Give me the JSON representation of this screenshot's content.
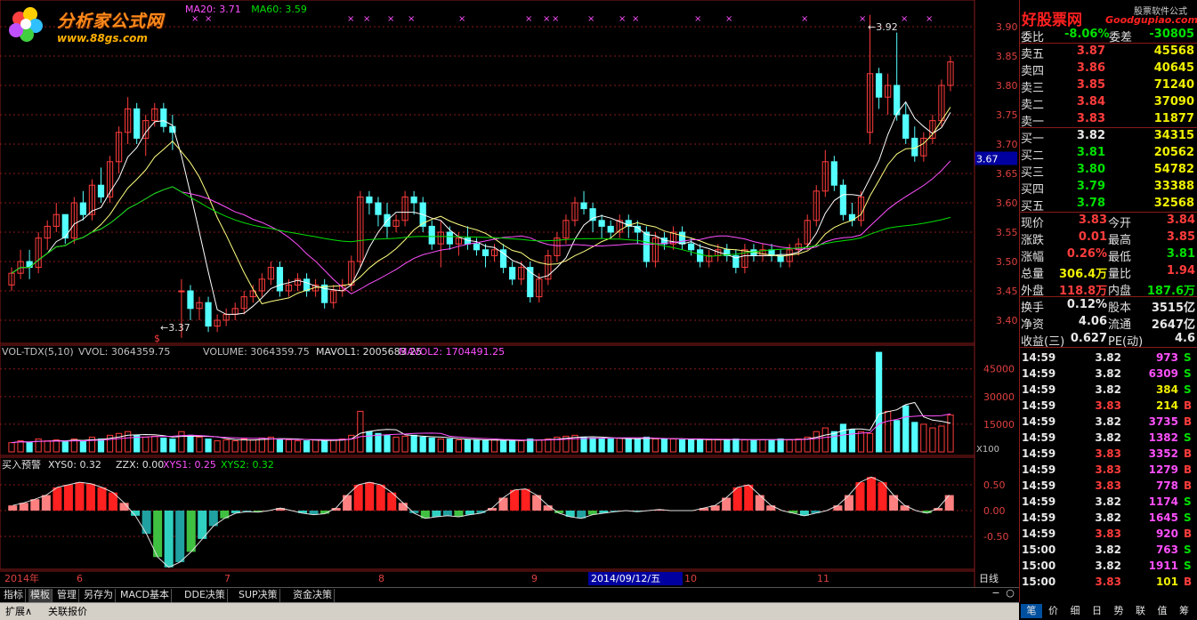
{
  "logo": {
    "title": "分析家公式网",
    "url": "www.88gs.com"
  },
  "ma_legend": [
    {
      "label": "MA20: 3.71",
      "color": "#ff50ff"
    },
    {
      "label": "MA60: 3.59",
      "color": "#00e000"
    }
  ],
  "brand": {
    "name": "好股票网",
    "url": "Goodgupiao.com",
    "sub": "股票软件公式"
  },
  "price_axis": [
    "3.90",
    "3.85",
    "3.80",
    "3.75",
    "3.70",
    "3.65",
    "3.60",
    "3.55",
    "3.50",
    "3.45",
    "3.40"
  ],
  "price_marker": "3.67",
  "price_high_label": "3.92",
  "price_low_label": "3.37",
  "vol_legend": {
    "name": "VOL-TDX(5,10)",
    "vvol": "VVOL: 3064359.75",
    "volume": "VOLUME: 3064359.75",
    "mavol1": "MAVOL1: 2005683.25",
    "mavol2": "MAVOL2: 1704491.25"
  },
  "vol_axis": [
    "45000",
    "30000",
    "15000"
  ],
  "vol_unit": "X100",
  "ind_legend": {
    "name": "买入预警",
    "xys0": "XYS0: 0.32",
    "zzx": "ZZX: 0.00",
    "xys1": "XYS1: 0.25",
    "xys2": "XYS2: 0.32"
  },
  "ind_axis": [
    "0.50",
    "0.00",
    "-0.50"
  ],
  "x_axis": [
    {
      "label": "2014年",
      "pos": 5
    },
    {
      "label": "6",
      "pos": 86
    },
    {
      "label": "7",
      "pos": 252
    },
    {
      "label": "8",
      "pos": 425
    },
    {
      "label": "9",
      "pos": 597
    },
    {
      "label": "10",
      "pos": 769
    },
    {
      "label": "11",
      "pos": 918
    }
  ],
  "date_cursor": "2014/09/12/五",
  "day_label": "日线",
  "quote": {
    "webi_label": "委比",
    "webi_value": "-8.06%",
    "wecha_label": "委差",
    "wecha_value": "-30805",
    "asks": [
      {
        "label": "卖五",
        "price": "3.87",
        "vol": "45568"
      },
      {
        "label": "卖四",
        "price": "3.86",
        "vol": "40645"
      },
      {
        "label": "卖三",
        "price": "3.85",
        "vol": "71240"
      },
      {
        "label": "卖二",
        "price": "3.84",
        "vol": "37090"
      },
      {
        "label": "卖一",
        "price": "3.83",
        "vol": "11877"
      }
    ],
    "bids": [
      {
        "label": "买一",
        "price": "3.82",
        "vol": "34315"
      },
      {
        "label": "买二",
        "price": "3.81",
        "vol": "20562"
      },
      {
        "label": "买三",
        "price": "3.80",
        "vol": "54782"
      },
      {
        "label": "买四",
        "price": "3.79",
        "vol": "33388"
      },
      {
        "label": "买五",
        "price": "3.78",
        "vol": "32568"
      }
    ],
    "stats": [
      {
        "k1": "现价",
        "v1": "3.83",
        "c1": "red",
        "k2": "今开",
        "v2": "3.84",
        "c2": "red"
      },
      {
        "k1": "涨跌",
        "v1": "0.01",
        "c1": "red",
        "k2": "最高",
        "v2": "3.85",
        "c2": "red"
      },
      {
        "k1": "涨幅",
        "v1": "0.26%",
        "c1": "red",
        "k2": "最低",
        "v2": "3.81",
        "c2": "green"
      },
      {
        "k1": "总量",
        "v1": "306.4万",
        "c1": "yellow",
        "k2": "量比",
        "v2": "1.94",
        "c2": "red"
      },
      {
        "k1": "外盘",
        "v1": "118.8万",
        "c1": "red",
        "k2": "内盘",
        "v2": "187.6万",
        "c2": "green"
      },
      {
        "k1": "换手",
        "v1": "0.12%",
        "c1": "white",
        "k2": "股本",
        "v2": "3515亿",
        "c2": "white"
      },
      {
        "k1": "净资",
        "v1": "4.06",
        "c1": "white",
        "k2": "流通",
        "v2": "2647亿",
        "c2": "white"
      },
      {
        "k1": "收益(三)",
        "v1": "0.627",
        "c1": "white",
        "k2": "PE(动)",
        "v2": "4.6",
        "c2": "white"
      }
    ]
  },
  "ticks": [
    {
      "time": "14:59",
      "price": "3.82",
      "pc": "white",
      "vol": "973",
      "vc": "magenta",
      "side": "S"
    },
    {
      "time": "14:59",
      "price": "3.82",
      "pc": "white",
      "vol": "6309",
      "vc": "magenta",
      "side": "S"
    },
    {
      "time": "14:59",
      "price": "3.82",
      "pc": "white",
      "vol": "384",
      "vc": "yellow",
      "side": "S"
    },
    {
      "time": "14:59",
      "price": "3.83",
      "pc": "red",
      "vol": "214",
      "vc": "yellow",
      "side": "B"
    },
    {
      "time": "14:59",
      "price": "3.82",
      "pc": "white",
      "vol": "3735",
      "vc": "magenta",
      "side": "B"
    },
    {
      "time": "14:59",
      "price": "3.82",
      "pc": "white",
      "vol": "1382",
      "vc": "magenta",
      "side": "S"
    },
    {
      "time": "14:59",
      "price": "3.83",
      "pc": "red",
      "vol": "3352",
      "vc": "magenta",
      "side": "B"
    },
    {
      "time": "14:59",
      "price": "3.83",
      "pc": "red",
      "vol": "1279",
      "vc": "magenta",
      "side": "B"
    },
    {
      "time": "14:59",
      "price": "3.83",
      "pc": "red",
      "vol": "778",
      "vc": "magenta",
      "side": "B"
    },
    {
      "time": "14:59",
      "price": "3.82",
      "pc": "white",
      "vol": "1174",
      "vc": "magenta",
      "side": "S"
    },
    {
      "time": "14:59",
      "price": "3.82",
      "pc": "white",
      "vol": "1645",
      "vc": "magenta",
      "side": "S"
    },
    {
      "time": "14:59",
      "price": "3.83",
      "pc": "red",
      "vol": "920",
      "vc": "magenta",
      "side": "B"
    },
    {
      "time": "15:00",
      "price": "3.82",
      "pc": "white",
      "vol": "763",
      "vc": "magenta",
      "side": "S"
    },
    {
      "time": "15:00",
      "price": "3.82",
      "pc": "white",
      "vol": "1911",
      "vc": "magenta",
      "side": "S"
    },
    {
      "time": "15:00",
      "price": "3.83",
      "pc": "red",
      "vol": "101",
      "vc": "yellow",
      "side": "B"
    }
  ],
  "tabs": [
    "指标",
    "模板",
    "管理",
    "另存为",
    "MACD基本",
    "DDE决策",
    "SUP决策",
    "资金决策"
  ],
  "status_tabs": [
    "扩展∧",
    "关联报价"
  ],
  "right_tabs": [
    "笔",
    "价",
    "细",
    "日",
    "势",
    "联",
    "值",
    "筹"
  ],
  "colors": {
    "up": "#ff3c3c",
    "down": "#54ffff",
    "grid": "#8a1a1a",
    "ma5": "#ffffff",
    "ma10": "#ffff80",
    "ma20": "#ff50ff",
    "ma60": "#00e000"
  },
  "chart_data": {
    "type": "candlestick",
    "ylim": [
      3.37,
      3.92
    ],
    "ohlc": [
      [
        3.46,
        3.49,
        3.45,
        3.48
      ],
      [
        3.48,
        3.52,
        3.47,
        3.5
      ],
      [
        3.5,
        3.52,
        3.47,
        3.49
      ],
      [
        3.49,
        3.55,
        3.48,
        3.54
      ],
      [
        3.54,
        3.57,
        3.52,
        3.56
      ],
      [
        3.56,
        3.6,
        3.55,
        3.58
      ],
      [
        3.58,
        3.58,
        3.53,
        3.54
      ],
      [
        3.54,
        3.61,
        3.53,
        3.6
      ],
      [
        3.6,
        3.62,
        3.57,
        3.58
      ],
      [
        3.58,
        3.64,
        3.57,
        3.63
      ],
      [
        3.63,
        3.66,
        3.6,
        3.61
      ],
      [
        3.61,
        3.68,
        3.6,
        3.67
      ],
      [
        3.67,
        3.73,
        3.65,
        3.72
      ],
      [
        3.72,
        3.78,
        3.7,
        3.76
      ],
      [
        3.76,
        3.77,
        3.7,
        3.71
      ],
      [
        3.71,
        3.75,
        3.68,
        3.74
      ],
      [
        3.74,
        3.77,
        3.73,
        3.76
      ],
      [
        3.76,
        3.77,
        3.72,
        3.73
      ],
      [
        3.73,
        3.75,
        3.69,
        3.72
      ],
      [
        3.45,
        3.47,
        3.37,
        3.45
      ],
      [
        3.45,
        3.46,
        3.4,
        3.42
      ],
      [
        3.42,
        3.44,
        3.4,
        3.43
      ],
      [
        3.43,
        3.44,
        3.38,
        3.39
      ],
      [
        3.39,
        3.41,
        3.38,
        3.4
      ],
      [
        3.4,
        3.42,
        3.39,
        3.41
      ],
      [
        3.41,
        3.43,
        3.4,
        3.42
      ],
      [
        3.42,
        3.45,
        3.41,
        3.44
      ],
      [
        3.44,
        3.46,
        3.43,
        3.45
      ],
      [
        3.45,
        3.48,
        3.44,
        3.47
      ],
      [
        3.47,
        3.5,
        3.46,
        3.49
      ],
      [
        3.49,
        3.5,
        3.44,
        3.45
      ],
      [
        3.45,
        3.47,
        3.44,
        3.46
      ],
      [
        3.46,
        3.48,
        3.45,
        3.47
      ],
      [
        3.47,
        3.48,
        3.44,
        3.45
      ],
      [
        3.45,
        3.47,
        3.44,
        3.46
      ],
      [
        3.46,
        3.47,
        3.42,
        3.43
      ],
      [
        3.43,
        3.46,
        3.42,
        3.45
      ],
      [
        3.45,
        3.47,
        3.44,
        3.46
      ],
      [
        3.46,
        3.51,
        3.45,
        3.5
      ],
      [
        3.5,
        3.62,
        3.49,
        3.61
      ],
      [
        3.61,
        3.62,
        3.58,
        3.6
      ],
      [
        3.6,
        3.61,
        3.56,
        3.58
      ],
      [
        3.58,
        3.6,
        3.54,
        3.56
      ],
      [
        3.56,
        3.58,
        3.55,
        3.57
      ],
      [
        3.57,
        3.62,
        3.56,
        3.61
      ],
      [
        3.61,
        3.62,
        3.58,
        3.6
      ],
      [
        3.6,
        3.61,
        3.55,
        3.56
      ],
      [
        3.56,
        3.57,
        3.52,
        3.53
      ],
      [
        3.53,
        3.57,
        3.49,
        3.55
      ],
      [
        3.55,
        3.56,
        3.52,
        3.53
      ],
      [
        3.53,
        3.55,
        3.51,
        3.54
      ],
      [
        3.54,
        3.56,
        3.52,
        3.53
      ],
      [
        3.53,
        3.54,
        3.51,
        3.52
      ],
      [
        3.52,
        3.53,
        3.49,
        3.51
      ],
      [
        3.51,
        3.53,
        3.5,
        3.52
      ],
      [
        3.52,
        3.53,
        3.48,
        3.49
      ],
      [
        3.49,
        3.5,
        3.46,
        3.47
      ],
      [
        3.47,
        3.5,
        3.46,
        3.49
      ],
      [
        3.49,
        3.5,
        3.43,
        3.44
      ],
      [
        3.44,
        3.48,
        3.43,
        3.47
      ],
      [
        3.47,
        3.52,
        3.46,
        3.51
      ],
      [
        3.51,
        3.55,
        3.5,
        3.54
      ],
      [
        3.54,
        3.58,
        3.53,
        3.57
      ],
      [
        3.57,
        3.61,
        3.56,
        3.6
      ],
      [
        3.6,
        3.62,
        3.58,
        3.59
      ],
      [
        3.59,
        3.6,
        3.55,
        3.57
      ],
      [
        3.57,
        3.58,
        3.54,
        3.56
      ],
      [
        3.56,
        3.57,
        3.54,
        3.55
      ],
      [
        3.55,
        3.58,
        3.54,
        3.57
      ],
      [
        3.57,
        3.58,
        3.54,
        3.56
      ],
      [
        3.56,
        3.57,
        3.53,
        3.55
      ],
      [
        3.55,
        3.56,
        3.49,
        3.5
      ],
      [
        3.5,
        3.55,
        3.49,
        3.54
      ],
      [
        3.54,
        3.55,
        3.52,
        3.53
      ],
      [
        3.53,
        3.56,
        3.52,
        3.55
      ],
      [
        3.55,
        3.56,
        3.52,
        3.53
      ],
      [
        3.53,
        3.54,
        3.51,
        3.52
      ],
      [
        3.52,
        3.53,
        3.49,
        3.5
      ],
      [
        3.5,
        3.52,
        3.49,
        3.51
      ],
      [
        3.51,
        3.53,
        3.5,
        3.52
      ],
      [
        3.52,
        3.53,
        3.5,
        3.51
      ],
      [
        3.51,
        3.52,
        3.48,
        3.49
      ],
      [
        3.49,
        3.53,
        3.48,
        3.52
      ],
      [
        3.52,
        3.53,
        3.5,
        3.51
      ],
      [
        3.51,
        3.53,
        3.5,
        3.52
      ],
      [
        3.52,
        3.53,
        3.5,
        3.51
      ],
      [
        3.51,
        3.52,
        3.49,
        3.5
      ],
      [
        3.5,
        3.53,
        3.49,
        3.52
      ],
      [
        3.52,
        3.54,
        3.51,
        3.53
      ],
      [
        3.53,
        3.58,
        3.52,
        3.57
      ],
      [
        3.57,
        3.63,
        3.56,
        3.62
      ],
      [
        3.62,
        3.69,
        3.61,
        3.67
      ],
      [
        3.67,
        3.68,
        3.62,
        3.63
      ],
      [
        3.63,
        3.64,
        3.57,
        3.58
      ],
      [
        3.58,
        3.6,
        3.56,
        3.57
      ],
      [
        3.57,
        3.62,
        3.56,
        3.61
      ],
      [
        3.72,
        3.92,
        3.7,
        3.82
      ],
      [
        3.82,
        3.83,
        3.76,
        3.78
      ],
      [
        3.78,
        3.82,
        3.75,
        3.8
      ],
      [
        3.8,
        3.89,
        3.74,
        3.75
      ],
      [
        3.75,
        3.77,
        3.7,
        3.71
      ],
      [
        3.71,
        3.73,
        3.67,
        3.68
      ],
      [
        3.68,
        3.72,
        3.67,
        3.71
      ],
      [
        3.71,
        3.75,
        3.7,
        3.74
      ],
      [
        3.74,
        3.81,
        3.73,
        3.8
      ],
      [
        3.8,
        3.85,
        3.79,
        3.84
      ]
    ]
  }
}
